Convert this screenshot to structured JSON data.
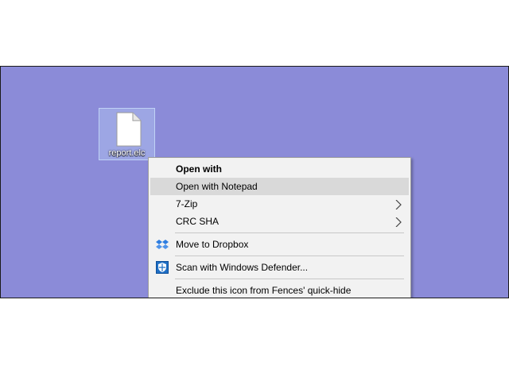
{
  "desktop": {
    "background_color": "#8b8bd8",
    "file": {
      "name": "report.elc",
      "icon": "document-icon"
    }
  },
  "context_menu": {
    "items": [
      {
        "label": "Open with",
        "bold": true
      },
      {
        "label": "Open with Notepad",
        "highlighted": true
      },
      {
        "label": "7-Zip",
        "submenu": true
      },
      {
        "label": "CRC SHA",
        "submenu": true
      },
      {
        "label": "Move to Dropbox",
        "icon": "dropbox-icon"
      },
      {
        "label": "Scan with Windows Defender...",
        "icon": "windows-defender-icon"
      },
      {
        "label": "Exclude this icon from Fences' quick-hide"
      }
    ]
  }
}
